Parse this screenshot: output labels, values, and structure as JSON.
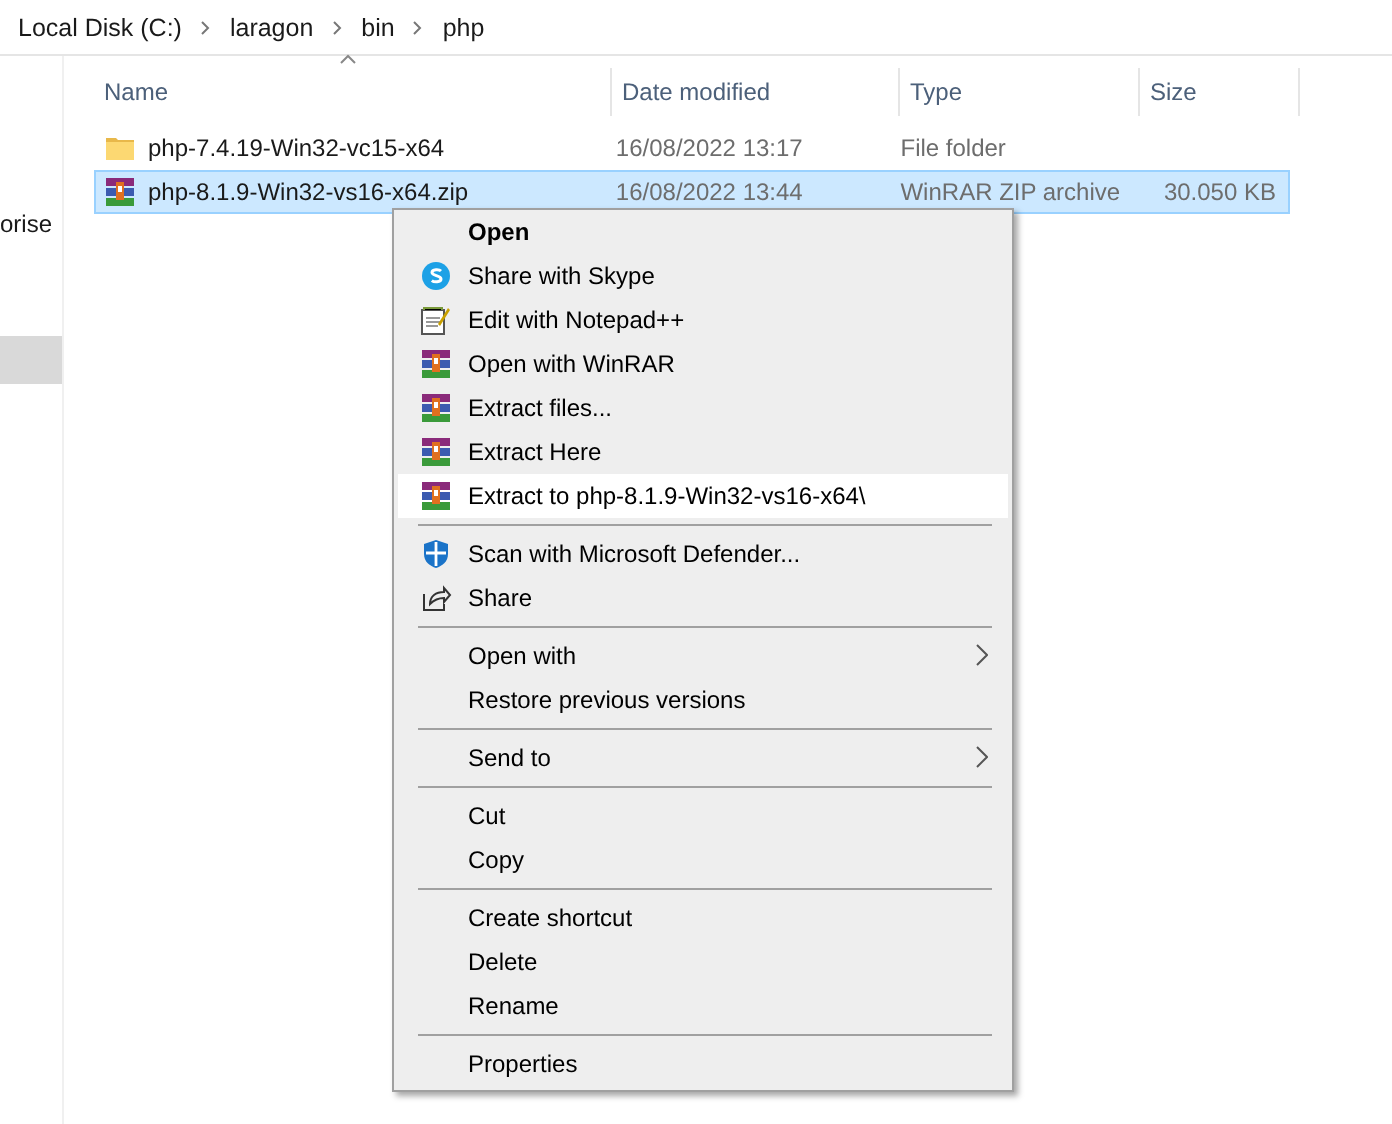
{
  "breadcrumb": [
    "Local Disk (C:)",
    "laragon",
    "bin",
    "php"
  ],
  "sidebar": {
    "items": [
      {
        "label": "orise",
        "selected": false
      },
      {
        "selected": true
      }
    ]
  },
  "table": {
    "columns": [
      {
        "label": "Name",
        "sorted": true
      },
      {
        "label": "Date modified",
        "sorted": false
      },
      {
        "label": "Type",
        "sorted": false
      },
      {
        "label": "Size",
        "sorted": false
      }
    ],
    "rows": [
      {
        "kind": "folder",
        "name": "php-7.4.19-Win32-vc15-x64",
        "date": "16/08/2022 13:17",
        "type": "File folder",
        "size": "",
        "selected": false
      },
      {
        "kind": "zip",
        "name": "php-8.1.9-Win32-vs16-x64.zip",
        "date": "16/08/2022 13:44",
        "type": "WinRAR ZIP archive",
        "size": "30.050 KB",
        "selected": true
      }
    ]
  },
  "context_menu": {
    "items": [
      {
        "kind": "item",
        "label": "Open",
        "default": true
      },
      {
        "kind": "skype",
        "label": "Share with Skype"
      },
      {
        "kind": "notepad",
        "label": "Edit with Notepad++"
      },
      {
        "kind": "winrar",
        "label": "Open with WinRAR"
      },
      {
        "kind": "winrar",
        "label": "Extract files..."
      },
      {
        "kind": "winrar",
        "label": "Extract Here"
      },
      {
        "kind": "winrar",
        "label": "Extract to php-8.1.9-Win32-vs16-x64\\",
        "highlighted": true
      },
      {
        "kind": "separator"
      },
      {
        "kind": "defender",
        "label": "Scan with Microsoft Defender..."
      },
      {
        "kind": "share",
        "label": "Share"
      },
      {
        "kind": "separator"
      },
      {
        "kind": "item",
        "label": "Open with",
        "submenu": true
      },
      {
        "kind": "item",
        "label": "Restore previous versions"
      },
      {
        "kind": "separator"
      },
      {
        "kind": "item",
        "label": "Send to",
        "submenu": true
      },
      {
        "kind": "separator"
      },
      {
        "kind": "item",
        "label": "Cut"
      },
      {
        "kind": "item",
        "label": "Copy"
      },
      {
        "kind": "separator"
      },
      {
        "kind": "item",
        "label": "Create shortcut"
      },
      {
        "kind": "item",
        "label": "Delete"
      },
      {
        "kind": "item",
        "label": "Rename"
      },
      {
        "kind": "separator"
      },
      {
        "kind": "item",
        "label": "Properties"
      }
    ]
  }
}
